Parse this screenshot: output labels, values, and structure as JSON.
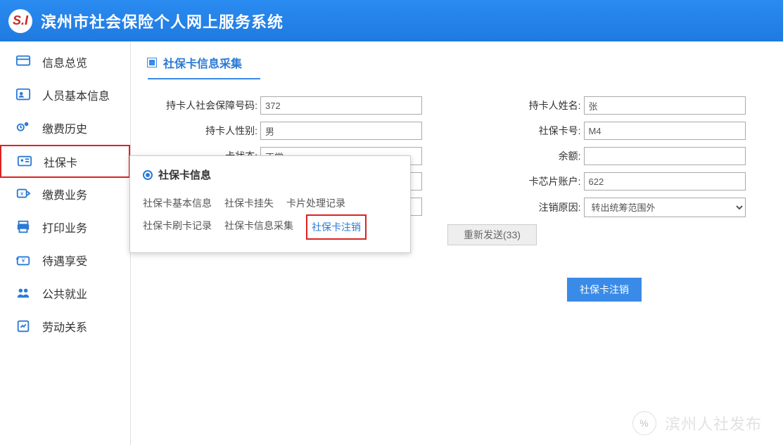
{
  "header": {
    "logo_text": "S.I",
    "title": "滨州市社会保险个人网上服务系统"
  },
  "sidebar": {
    "items": [
      {
        "label": "信息总览",
        "icon": "overview-icon"
      },
      {
        "label": "人员基本信息",
        "icon": "person-icon"
      },
      {
        "label": "缴费历史",
        "icon": "history-icon"
      },
      {
        "label": "社保卡",
        "icon": "card-icon",
        "active": true
      },
      {
        "label": "缴费业务",
        "icon": "payment-icon"
      },
      {
        "label": "打印业务",
        "icon": "print-icon"
      },
      {
        "label": "待遇享受",
        "icon": "benefit-icon"
      },
      {
        "label": "公共就业",
        "icon": "employment-icon"
      },
      {
        "label": "劳动关系",
        "icon": "labor-icon"
      }
    ]
  },
  "page": {
    "title": "社保卡信息采集"
  },
  "form": {
    "ssn_label": "持卡人社会保障号码:",
    "ssn_value": "372",
    "name_label": "持卡人姓名:",
    "name_value": "张",
    "gender_label": "持卡人性别:",
    "gender_value": "男",
    "card_no_label": "社保卡号:",
    "card_no_value": "M4",
    "status_label": "卡状态:",
    "status_value": "正常",
    "balance_label": "余额:",
    "balance_value": "",
    "chip_label": "卡芯片账户:",
    "chip_value": "622",
    "cancel_reason_label": "注销原因:",
    "cancel_reason_value": "转出统筹范围外"
  },
  "popup": {
    "title": "社保卡信息",
    "links": [
      "社保卡基本信息",
      "社保卡挂失",
      "卡片处理记录",
      "社保卡刷卡记录",
      "社保卡信息采集",
      "社保卡注销"
    ]
  },
  "buttons": {
    "resend": "重新发送(33)",
    "cancel_card": "社保卡注销"
  },
  "watermark": {
    "icon_text": "%",
    "text": "滨州人社发布"
  }
}
